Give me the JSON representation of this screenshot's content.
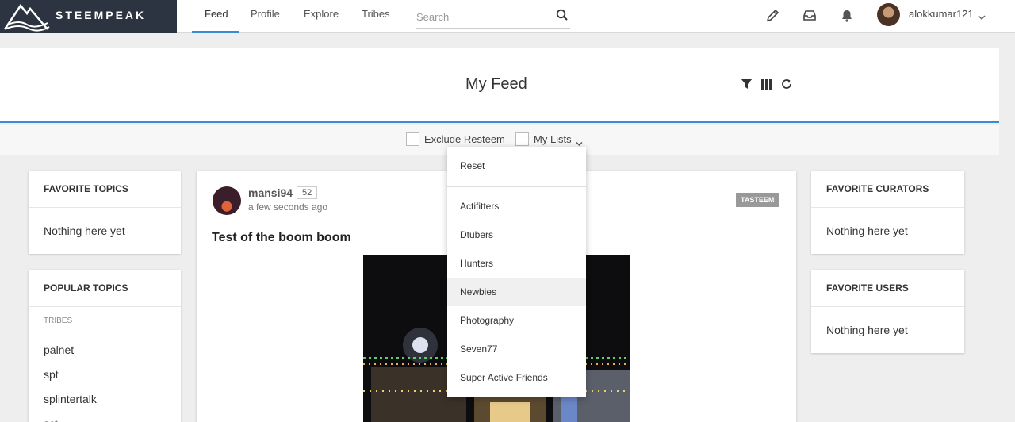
{
  "brand": {
    "name": "STEEMPEAK"
  },
  "nav": {
    "items": [
      {
        "label": "Feed",
        "active": true
      },
      {
        "label": "Profile"
      },
      {
        "label": "Explore"
      },
      {
        "label": "Tribes"
      }
    ],
    "search_placeholder": "Search"
  },
  "user": {
    "name": "alokkumar121"
  },
  "icons": [
    "pencil-icon",
    "inbox-icon",
    "bell-icon",
    "chevron-down-icon",
    "search-icon",
    "filter-icon",
    "grid-icon",
    "refresh-icon"
  ],
  "header": {
    "title": "My Feed"
  },
  "filters": {
    "exclude_resteem": "Exclude Resteem",
    "my_lists": "My Lists"
  },
  "left": {
    "favorite_topics": {
      "title": "Favorite Topics",
      "empty": "Nothing here yet"
    },
    "popular_topics": {
      "title": "Popular Topics",
      "tribes_label": "Tribes",
      "tribes": [
        "palnet",
        "spt",
        "splintertalk",
        "sct"
      ]
    }
  },
  "post": {
    "author": "mansi94",
    "reputation": "52",
    "time": "a few seconds ago",
    "tag": "TASTEEM",
    "title": "Test of the boom boom"
  },
  "right": {
    "favorite_curators": {
      "title": "Favorite Curators",
      "empty": "Nothing here yet"
    },
    "favorite_users": {
      "title": "Favorite Users",
      "empty": "Nothing here yet"
    }
  },
  "dropdown": {
    "reset": "Reset",
    "lists": [
      "Actifitters",
      "Dtubers",
      "Hunters",
      "Newbies",
      "Photography",
      "Seven77",
      "Super Active Friends"
    ],
    "hovered": "Newbies"
  },
  "colors": {
    "accent": "#3a8bd0",
    "logo_bg": "#2b3440"
  }
}
